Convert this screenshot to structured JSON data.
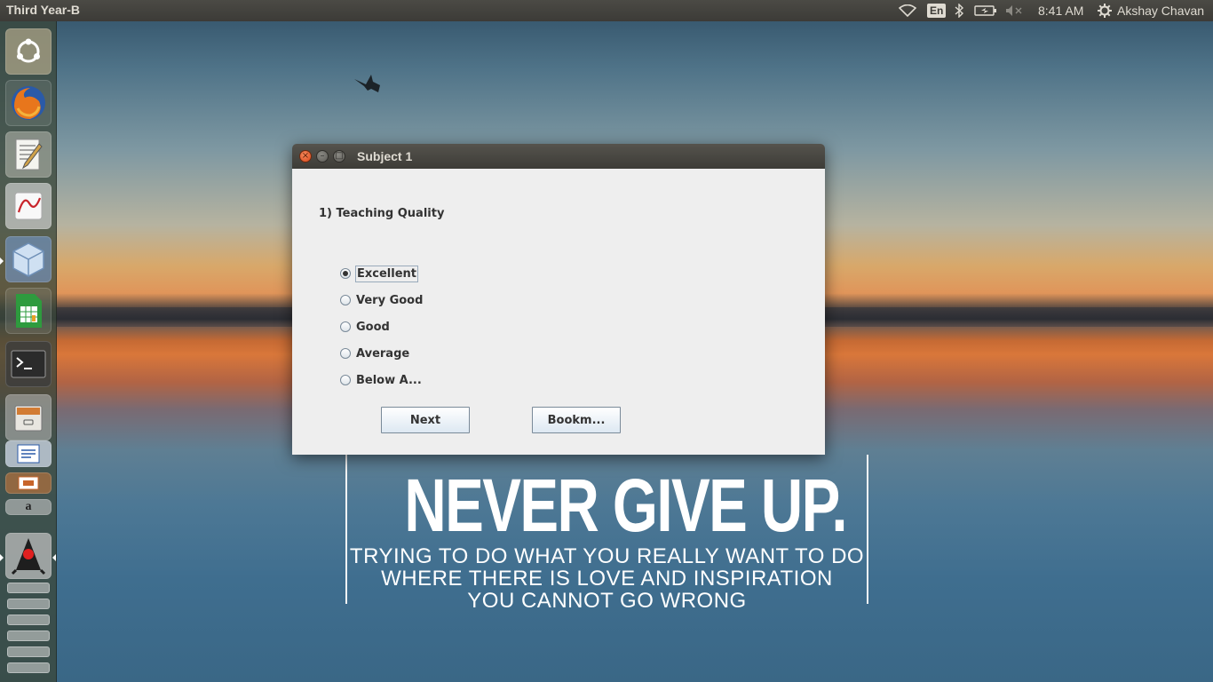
{
  "panel": {
    "title": "Third Year-B",
    "language": "En",
    "time": "8:41 AM",
    "user": "Akshay Chavan"
  },
  "launcher": {
    "items": [
      {
        "name": "dash-icon"
      },
      {
        "name": "firefox-icon"
      },
      {
        "name": "text-editor-icon"
      },
      {
        "name": "pdf-reader-icon"
      },
      {
        "name": "virtualbox-icon"
      },
      {
        "name": "spreadsheet-icon"
      },
      {
        "name": "terminal-icon"
      },
      {
        "name": "file-cabinet-icon"
      }
    ]
  },
  "wallpaper": {
    "headline": "NEVER GIVE UP.",
    "lines": [
      "TRYING TO DO WHAT YOU REALLY WANT TO DO",
      "WHERE THERE IS LOVE AND INSPIRATION",
      "YOU CANNOT GO WRONG"
    ]
  },
  "dialog": {
    "title": "Subject 1",
    "question": "1) Teaching Quality",
    "options": [
      "Excellent",
      "Very Good",
      "Good",
      "Average",
      "Below A..."
    ],
    "selected_option": "Excellent",
    "next_label": "Next",
    "bookmark_label": "Bookm..."
  }
}
